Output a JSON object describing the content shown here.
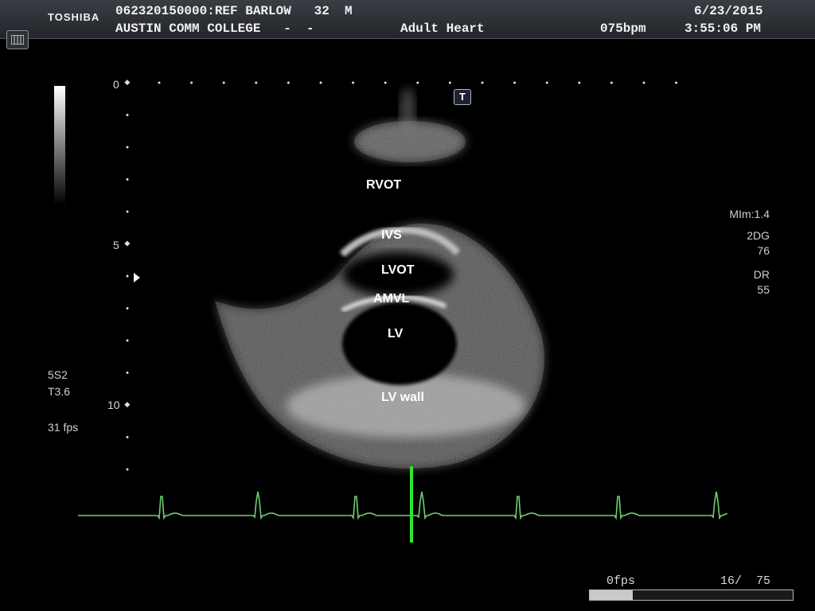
{
  "header": {
    "brand": "TOSHIBA",
    "patient_line": "062320150000:REF BARLOW   32  M",
    "institution_line": "AUSTIN COMM COLLEGE   -  -",
    "preset": "Adult Heart",
    "date": "6/23/2015",
    "heart_rate": "075bpm",
    "time": "3:55:06 PM"
  },
  "left_panel": {
    "probe": "5S2",
    "setting": "T3.6",
    "frame_rate": "31 fps"
  },
  "right_panel": {
    "mi": "MIm:1.4",
    "gain_label": "2DG",
    "gain_value": "76",
    "dr_label": "DR",
    "dr_value": "55"
  },
  "depth_scale": {
    "labels": [
      "0",
      "5",
      "10"
    ]
  },
  "marker_badge": "T",
  "annotations": {
    "rvot": "RVOT",
    "ivs": "IVS",
    "lvot": "LVOT",
    "amvl": "AMVL",
    "lv": "LV",
    "lv_wall": "LV wall"
  },
  "playback": {
    "fps_label": "0fps",
    "frame_counter": "16/  75",
    "progress_fraction": 0.21
  },
  "colors": {
    "ecg": "#6fcf6f",
    "cursor": "#2ee52e",
    "header_bg": "#2e3136"
  }
}
